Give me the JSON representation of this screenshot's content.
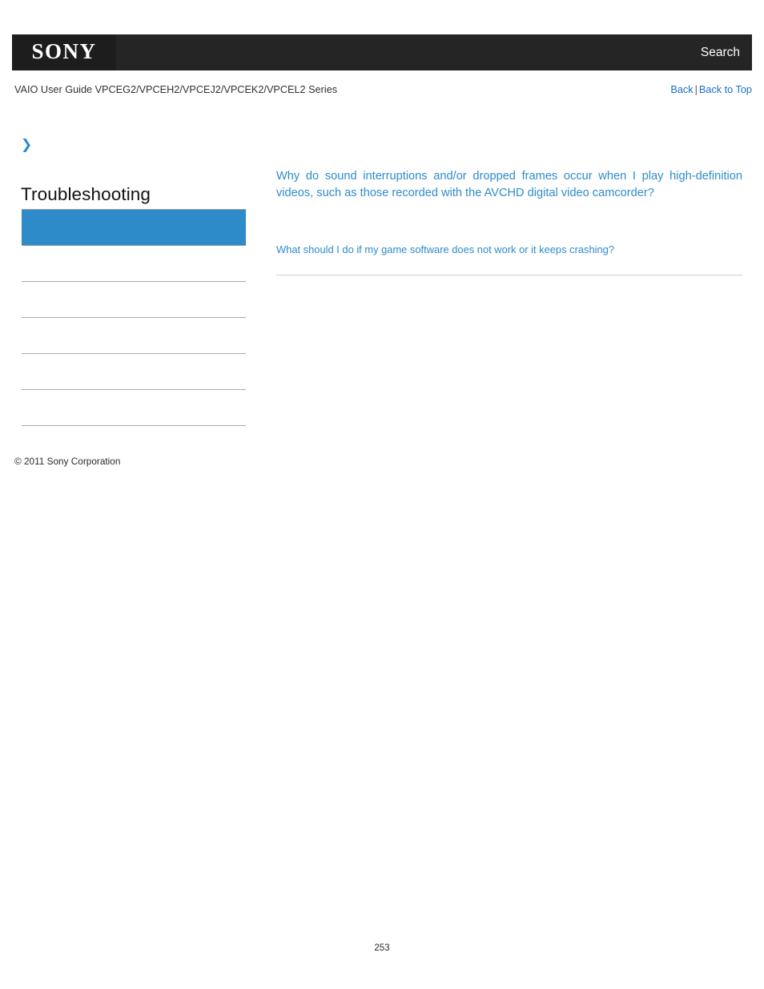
{
  "header": {
    "logo_text": "SONY",
    "search_label": "Search",
    "bar_color": "#252525",
    "logo_block_color": "#1d1d1d"
  },
  "subheader": {
    "guide_title": "VAIO User Guide VPCEG2/VPCEH2/VPCEJ2/VPCEK2/VPCEL2 Series",
    "back_label": "Back",
    "separator": "|",
    "back_to_top_label": "Back to Top",
    "link_color": "#1a6fc4"
  },
  "sidebar": {
    "breadcrumb_icon": "chevron-right-icon",
    "breadcrumb_glyph": "❯",
    "breadcrumb_text": "",
    "heading": "Troubleshooting",
    "accent_color": "#2e8bca",
    "items": [
      {
        "label": "",
        "active": true
      },
      {
        "label": "",
        "active": false
      },
      {
        "label": "",
        "active": false
      },
      {
        "label": "",
        "active": false
      },
      {
        "label": "",
        "active": false
      },
      {
        "label": "",
        "active": false
      }
    ],
    "copyright": "© 2011 Sony Corporation"
  },
  "main": {
    "topics": [
      {
        "text": "Why do sound interruptions and/or dropped frames occur when I play high-definition videos, such as those recorded with the AVCHD digital video camcorder?",
        "size": "large"
      },
      {
        "text": "What should I do if my game software does not work or it keeps crashing?",
        "size": "small"
      }
    ],
    "link_color": "#2e8bca"
  },
  "footer": {
    "page_number": "253"
  }
}
